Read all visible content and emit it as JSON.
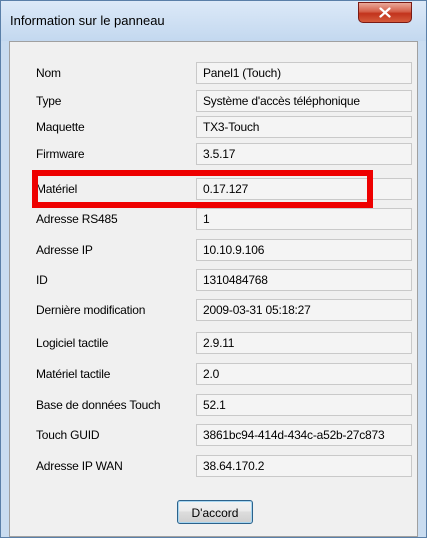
{
  "window": {
    "title": "Information sur le panneau",
    "close_label": "x"
  },
  "fields": [
    {
      "label": "Nom",
      "value": "Panel1 (Touch)"
    },
    {
      "label": "Type",
      "value": "Système d'accès téléphonique"
    },
    {
      "label": "Maquette",
      "value": "TX3-Touch"
    },
    {
      "label": "Firmware",
      "value": "3.5.17"
    },
    {
      "label": "Matériel",
      "value": "0.17.127"
    },
    {
      "label": "Adresse RS485",
      "value": "1"
    },
    {
      "label": "Adresse IP",
      "value": "10.10.9.106"
    },
    {
      "label": "ID",
      "value": "1310484768"
    },
    {
      "label": "Dernière modification",
      "value": "2009-03-31 05:18:27"
    },
    {
      "label": "Logiciel tactile",
      "value": "2.9.11"
    },
    {
      "label": "Matériel tactile",
      "value": "2.0"
    },
    {
      "label": "Base de données Touch",
      "value": "52.1"
    },
    {
      "label": "Touch GUID",
      "value": "3861bc94-414d-434c-a52b-27c873"
    },
    {
      "label": "Adresse IP WAN",
      "value": "38.64.170.2"
    }
  ],
  "ok_button": {
    "label": "D'accord"
  },
  "colors": {
    "highlight": "#ee0000",
    "title_bar": "#c9dcf0",
    "close_button": "#c2331c"
  }
}
